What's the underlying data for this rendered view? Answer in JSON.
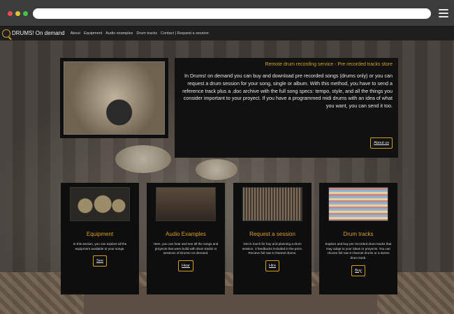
{
  "navbar": {
    "brand": "DRUMS! On demand",
    "links": [
      "About",
      "Equipment",
      "Audio examples",
      "Drum tracks",
      "Contact | Request a session"
    ]
  },
  "intro": {
    "title": "Remote drum recording service - Pre recorded tracks store",
    "body": "In Drums! on demand you can buy and download pre recorded songs (drums only) or you can request a drum session for your song, single or album. With this method, you have to send a reference track plus a .doc archive with the full song specs: tempo, style, and all the things you consider important to your proyect. If you have a programmed midi drums with an idea of what you want, you can send it too.",
    "button": "About us"
  },
  "cards": [
    {
      "title": "Equipment",
      "desc": "In this section, you can explore all the equipment available to your songs.",
      "button": "See"
    },
    {
      "title": "Audio Examples",
      "desc": "Here, you can hear and see all the songs and proyects that were build with drum tracks or sessions of Drums! on demand.",
      "button": "Hear"
    },
    {
      "title": "Request a session",
      "desc": "Get in touch for buy and planning a drum session. 3 feedbacks included in the price. Recieve full raw 8 channel drums.",
      "button": "Hire"
    },
    {
      "title": "Drum tracks",
      "desc": "Explore and buy pre recorded drum tracks that may adapt to your ideas or proyects. You can choose full raw 8 channel drums or a stereo drum track.",
      "button": "Buy"
    }
  ],
  "colors": {
    "accent": "#d4a017",
    "panel": "#111111",
    "navbar": "#1e1e1e"
  }
}
